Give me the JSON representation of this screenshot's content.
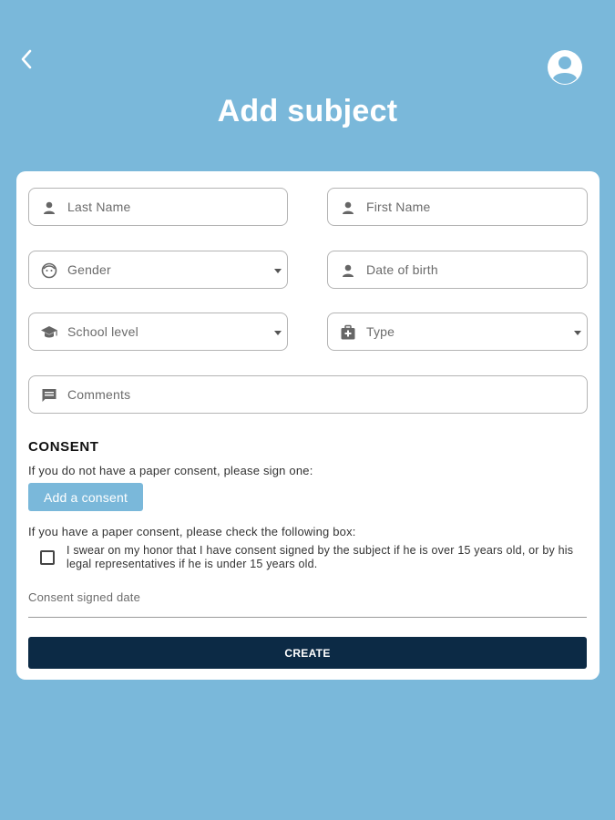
{
  "header": {
    "title": "Add subject",
    "back_icon": "chevron-left-icon",
    "profile_icon": "account-circle-icon"
  },
  "form": {
    "last_name": {
      "placeholder": "Last Name",
      "icon": "person-icon"
    },
    "first_name": {
      "placeholder": "First Name",
      "icon": "person-icon"
    },
    "gender": {
      "placeholder": "Gender",
      "icon": "face-icon"
    },
    "date_of_birth": {
      "placeholder": "Date of birth",
      "icon": "person-icon"
    },
    "school_level": {
      "placeholder": "School level",
      "icon": "graduation-cap-icon"
    },
    "type": {
      "placeholder": "Type",
      "icon": "medical-bag-icon"
    },
    "comments": {
      "placeholder": "Comments",
      "icon": "comment-icon"
    }
  },
  "consent": {
    "title": "CONSENT",
    "no_paper_text": "If you do not have a paper consent, please sign one:",
    "add_consent_label": "Add a consent",
    "paper_text": "If you have a paper consent, please check the following box:",
    "checkbox_label": "I swear on my honor that I have consent signed by the subject if he is over 15 years old, or by his legal representatives if he is under 15 years old.",
    "signed_date_placeholder": "Consent signed date"
  },
  "actions": {
    "create_label": "CREATE"
  },
  "colors": {
    "background": "#7ab8da",
    "primary_dark": "#0c2a45",
    "accent": "#7ab8da"
  }
}
